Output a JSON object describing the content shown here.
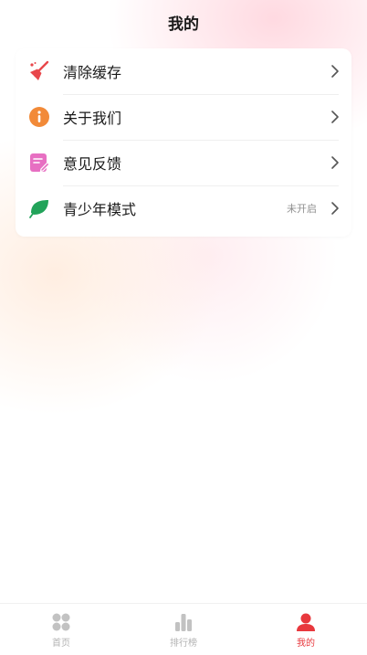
{
  "header": {
    "title": "我的"
  },
  "menu": {
    "items": [
      {
        "icon": "broom-icon",
        "label": "清除缓存",
        "status": ""
      },
      {
        "icon": "info-icon",
        "label": "关于我们",
        "status": ""
      },
      {
        "icon": "feedback-icon",
        "label": "意见反馈",
        "status": ""
      },
      {
        "icon": "leaf-icon",
        "label": "青少年模式",
        "status": "未开启"
      }
    ]
  },
  "tabbar": {
    "tabs": [
      {
        "icon": "home-grid-icon",
        "label": "首页",
        "active": false
      },
      {
        "icon": "ranking-bars-icon",
        "label": "排行榜",
        "active": false
      },
      {
        "icon": "profile-icon",
        "label": "我的",
        "active": true
      }
    ]
  },
  "colors": {
    "accent": "#e8383d",
    "broom": "#e8474b",
    "info": "#f28a38",
    "feedback": "#e76fc2",
    "leaf": "#22a35a",
    "tab_inactive": "#c2c2c2"
  }
}
